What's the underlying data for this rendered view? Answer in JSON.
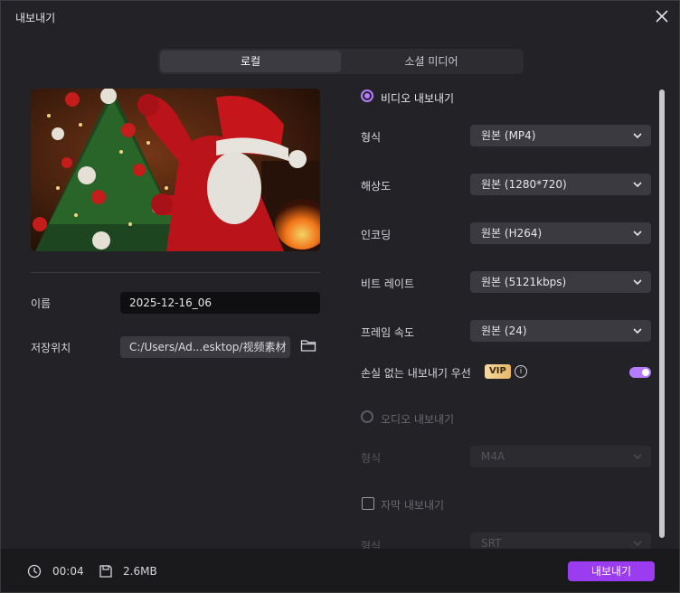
{
  "window": {
    "title": "내보내기"
  },
  "tabs": [
    {
      "label": "로컬",
      "active": true
    },
    {
      "label": "소셜 미디어",
      "active": false
    }
  ],
  "file": {
    "name_label": "이름",
    "name_value": "2025-12-16_06",
    "location_label": "저장위치",
    "location_value": "C:/Users/Ad...esktop/视频素材"
  },
  "video_export": {
    "title": "비디오 내보내기",
    "enabled": true,
    "rows": [
      {
        "label": "형식",
        "value": "원본 (MP4)"
      },
      {
        "label": "해상도",
        "value": "원본 (1280*720)"
      },
      {
        "label": "인코딩",
        "value": "원본 (H264)"
      },
      {
        "label": "비트 레이트",
        "value": "원본 (5121kbps)"
      },
      {
        "label": "프레임 속도",
        "value": "원본 (24)"
      }
    ],
    "lossless": {
      "label": "손실 없는 내보내기 우선",
      "badge": "VIP",
      "info": "i",
      "on": true
    }
  },
  "audio_export": {
    "title": "오디오 내보내기",
    "enabled": false,
    "format_label": "형식",
    "format_value": "M4A"
  },
  "subtitle_export": {
    "title": "자막 내보내기",
    "checked": false,
    "format_label": "형식",
    "format_value": "SRT"
  },
  "footer": {
    "duration": "00:04",
    "size": "2.6MB",
    "export_label": "내보내기"
  },
  "colors": {
    "accent": "#b67cff",
    "export_button": "#9b3cf0",
    "vip_badge": "#e7b766"
  }
}
